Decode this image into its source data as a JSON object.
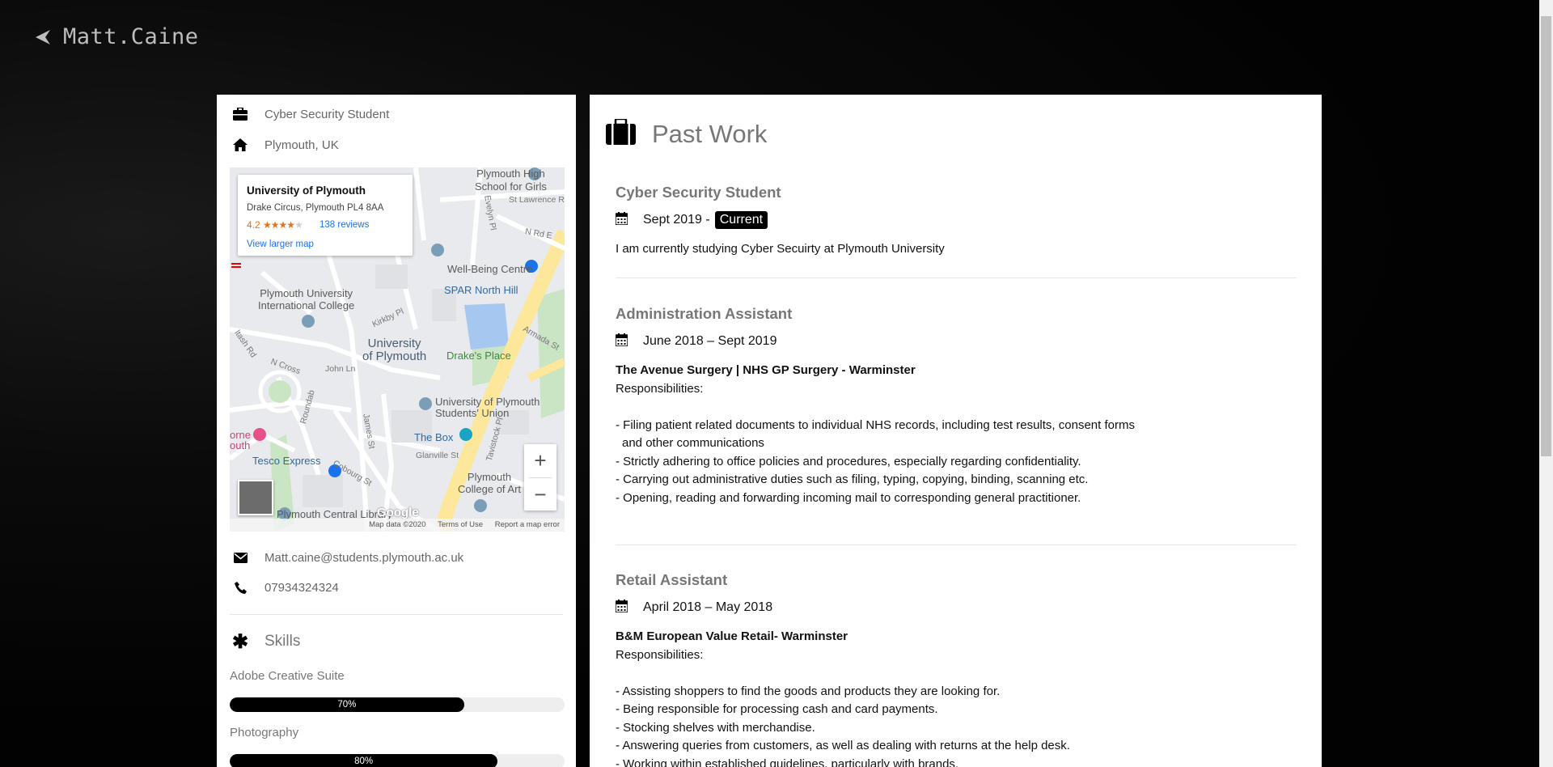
{
  "nav": {
    "brand": "Matt.Caine"
  },
  "profile": {
    "role": "Cyber Security Student",
    "location": "Plymouth, UK",
    "email": "Matt.caine@students.plymouth.ac.uk",
    "phone": "07934324324"
  },
  "map": {
    "place_name": "University of Plymouth",
    "address": "Drake Circus, Plymouth PL4 8AA",
    "rating": "4.2",
    "reviews": "138 reviews",
    "view_larger": "View larger map",
    "footer": [
      "Map data ©2020",
      "Terms of Use",
      "Report a map error"
    ],
    "logo": "Google",
    "labels": {
      "high_school": "Plymouth High\nSchool for Girls",
      "st_lawrence": "St Lawrence Rd",
      "wellbeing": "Well-Being Centre",
      "spar": "SPAR North Hill",
      "intl_college": "Plymouth University\nInternational College",
      "uni": "University\nof Plymouth",
      "drakes": "Drake's Place",
      "union": "University of Plymouth\nStudents' Union",
      "the_box": "The Box",
      "tesco": "Tesco Express",
      "college_art": "Plymouth\nCollege of Art",
      "library": "Plymouth Central Library",
      "john_ln": "John Ln",
      "n_cross": "N Cross",
      "cobourg": "Cobourg St",
      "glanville": "Glanville St",
      "armada": "Armada St",
      "kirkby": "Kirkby Pl",
      "saltash": "ltash Rd",
      "evelyn": "Evelyn Pl",
      "n_road_e": "N Rd E",
      "tavistock": "Tavistock Pl",
      "james": "James St",
      "roundab": "Roundab",
      "orne": "orne\nouth"
    }
  },
  "skills": {
    "heading": "Skills",
    "items": [
      {
        "name": "Adobe Creative Suite",
        "percent": 70,
        "label": "70%"
      },
      {
        "name": "Photography",
        "percent": 80,
        "label": "80%"
      }
    ]
  },
  "past_work": {
    "heading": "Past Work",
    "jobs": [
      {
        "title": "Cyber Security Student",
        "date": "Sept 2019 -",
        "badge": "Current",
        "description": "I am currently studying Cyber Secuirty at Plymouth University"
      },
      {
        "title": "Administration Assistant",
        "date": "June 2018 – Sept 2019",
        "company": "The Avenue Surgery | NHS GP Surgery - Warminster",
        "resp_label": "Responsibilities:",
        "bullets": [
          "- Filing patient related documents to individual NHS records, including test results, consent forms and other communications",
          "- Strictly adhering to office policies and procedures, especially regarding confidentiality.",
          "- Carrying out administrative duties such as filing, typing, copying, binding, scanning etc.",
          "- Opening, reading and forwarding incoming mail to corresponding general practitioner."
        ]
      },
      {
        "title": "Retail Assistant",
        "date": "April 2018 – May 2018",
        "company": "B&M European Value Retail- Warminster",
        "resp_label": "Responsibilities:",
        "bullets": [
          "- Assisting shoppers to find the goods and products they are looking for.",
          "- Being responsible for processing cash and card payments.",
          "- Stocking shelves with merchandise.",
          "- Answering queries from customers, as well as dealing with returns at the help desk.",
          "- Working within established guidelines, particularly with brands."
        ]
      }
    ]
  }
}
